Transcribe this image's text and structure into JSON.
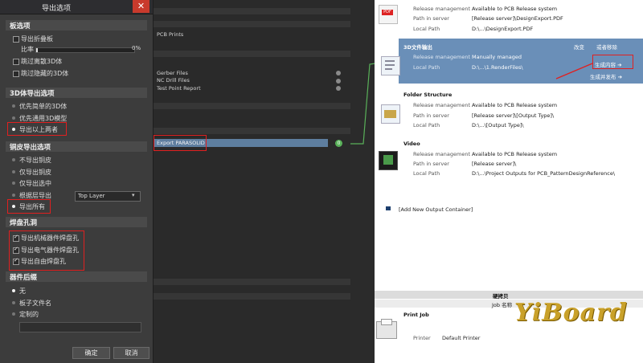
{
  "dialog": {
    "title": "导出选项",
    "close_glyph": "✕",
    "sections": {
      "board": "板选项",
      "export_3d": "3D体导出选项",
      "copper": "铜皮导出选项",
      "pad_holes": "焊盘孔洞",
      "component_suffix": "器件后缀"
    },
    "board_options": {
      "export_folded": "导出折叠板",
      "ratio_label": "比率",
      "ratio_value": "0%",
      "ratio_fraction": 0.0,
      "skip_free_3d": "跳过离散3D体",
      "skip_hidden_3d": "跳过隐藏的3D体"
    },
    "options_3d": {
      "prefer_simple": "优先简单的3D体",
      "prefer_generic": "优先通用3D模型",
      "export_both": "导出以上两者"
    },
    "copper_options": {
      "no_copper": "不导出铜皮",
      "pads_only": "仅导出铜皮",
      "selected_only": "仅导出选中",
      "by_layer": "根据层导出",
      "layer_select": "Top Layer",
      "export_all": "导出所有"
    },
    "pad_hole_options": {
      "mechanical": "导出机械器件焊盘孔",
      "electrical": "导出电气器件焊盘孔",
      "free": "导出自由焊盘孔"
    },
    "suffix_options": {
      "none": "无",
      "board_filename": "板子文件名",
      "custom": "定制的"
    },
    "ok_label": "确定",
    "cancel_label": "取消"
  },
  "middle": {
    "items": {
      "pcb_prints": "PCB Prints",
      "gerber": "Gerber Files",
      "nc_drill": "NC Drill Files",
      "test_point": "Test Point Report",
      "export_parasolid": "Export PARASOLID"
    },
    "connector_count": "0"
  },
  "right": {
    "pdf_container": {
      "rows": [
        {
          "label": "Release management",
          "value": "Available to PCB Release system"
        },
        {
          "label": "Path in server",
          "value": "[Release server]\\DesignExport.PDF"
        },
        {
          "label": "Local Path",
          "value": "D:\\...\\DesignExport.PDF"
        }
      ]
    },
    "container_3d": {
      "title": "3D文件输出",
      "change_label": "改变",
      "remove_label": "或者移除",
      "generate_label": "生成内容 ➔",
      "generate_publish_label": "生成并发布 ➔",
      "rows": [
        {
          "label": "Release management",
          "value": "Manually managed"
        },
        {
          "label": "Local Path",
          "value": "D:\\...\\1.RenderFiles\\"
        }
      ]
    },
    "folder_container": {
      "title": "Folder Structure",
      "rows": [
        {
          "label": "Release management",
          "value": "Available to PCB Release system"
        },
        {
          "label": "Path in server",
          "value": "[Release server]\\[Output Type]\\"
        },
        {
          "label": "Local Path",
          "value": "D:\\...\\[Output Type]\\"
        }
      ]
    },
    "video_container": {
      "title": "Video",
      "rows": [
        {
          "label": "Release management",
          "value": "Available to PCB Release system"
        },
        {
          "label": "Path in server",
          "value": "[Release server]\\"
        },
        {
          "label": "Local Path",
          "value": "D:\\...\\Project Outputs for PCB_PatternDesignReference\\"
        }
      ]
    },
    "add_container": "[Add New Output Container]",
    "hardcopy_header": "硬拷贝",
    "job_name_header": "Job 名称",
    "print_job": {
      "title": "Print Job",
      "printer_label": "Printer",
      "printer_value": "Default Printer"
    }
  },
  "watermark": {
    "text": "YiBoard"
  },
  "colors": {
    "dialog_bg": "#3c3c3c",
    "highlight_blue": "#6a8fb8",
    "selected_item": "#5e7e9f",
    "red_annotation": "#e02020",
    "connector_green": "#59b159"
  }
}
